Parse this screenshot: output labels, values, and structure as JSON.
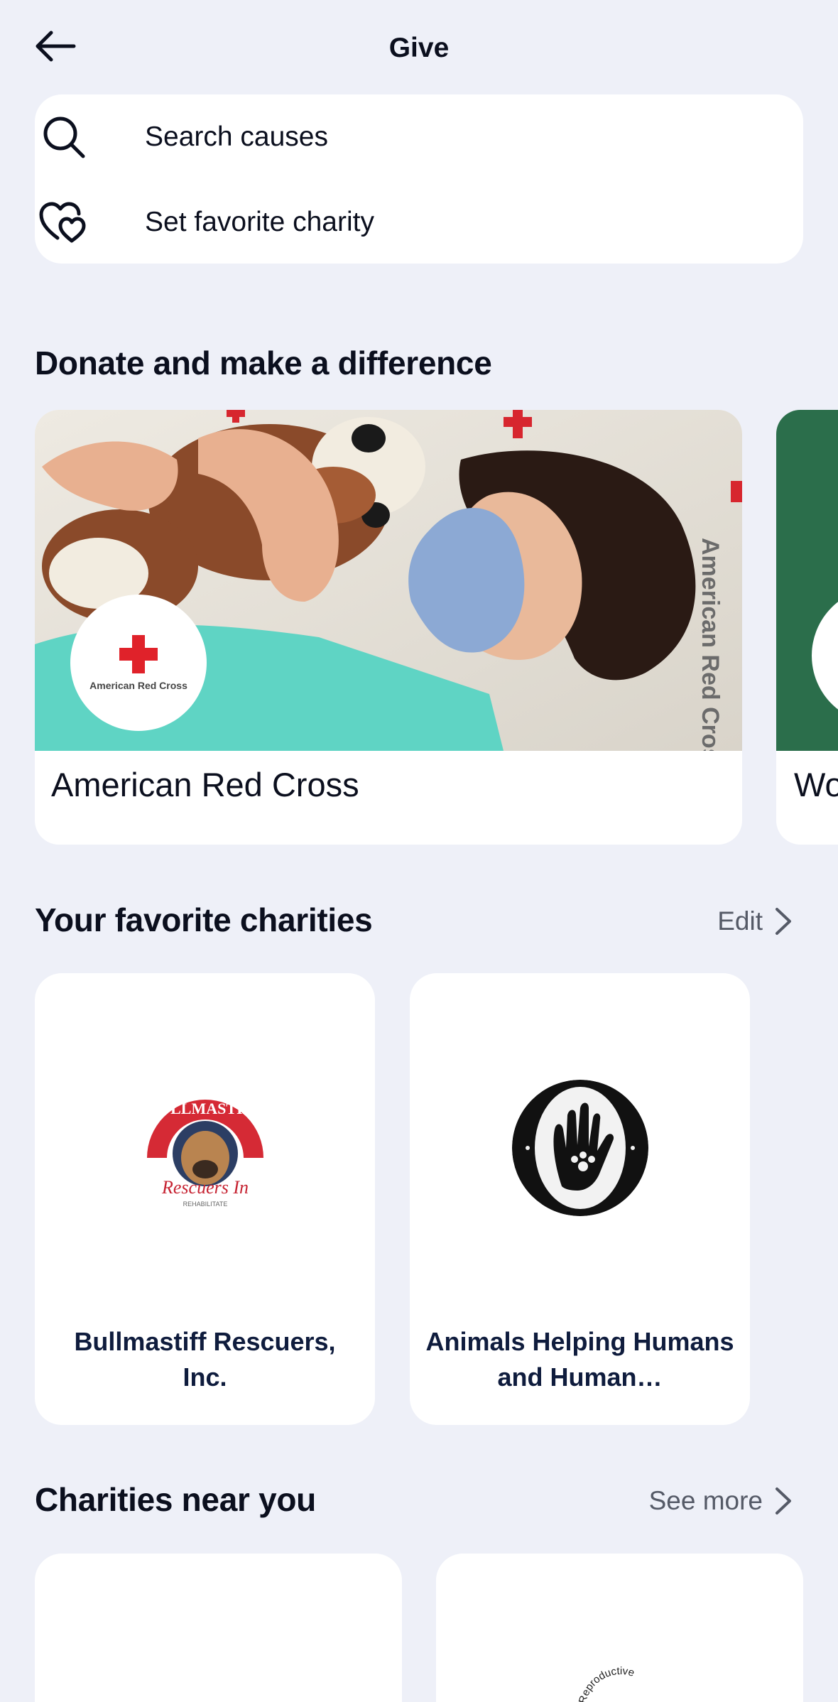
{
  "header": {
    "title": "Give",
    "back_icon": "arrow-left-icon"
  },
  "quick_actions": {
    "search_label": "Search causes",
    "search_icon": "search-icon",
    "favorite_label": "Set favorite charity",
    "favorite_icon": "hearts-icon"
  },
  "featured": {
    "title": "Donate and make a difference",
    "cards": [
      {
        "name": "American Red Cross",
        "logo_text": "American Red Cross",
        "photo_text": "American Red Cross"
      },
      {
        "name": "Wo"
      }
    ]
  },
  "favorites": {
    "title": "Your favorite charities",
    "edit_label": "Edit",
    "items": [
      {
        "name": "Bullmastiff Rescuers, Inc.",
        "logo_top": "BULLMASTIFF",
        "logo_script": "Rescuers In",
        "logo_tagline": "REHABILITATE"
      },
      {
        "name": "Animals Helping Humans and Human…"
      }
    ]
  },
  "nearby": {
    "title": "Charities near you",
    "see_more_label": "See more",
    "items": [
      {
        "name": ""
      },
      {
        "logo_text": "Reproductive"
      }
    ]
  },
  "colors": {
    "background": "#eef0f8",
    "card": "#ffffff",
    "red_cross": "#e0222a",
    "charity_name": "#0f1c3d",
    "green_card": "#2b6e4b"
  }
}
